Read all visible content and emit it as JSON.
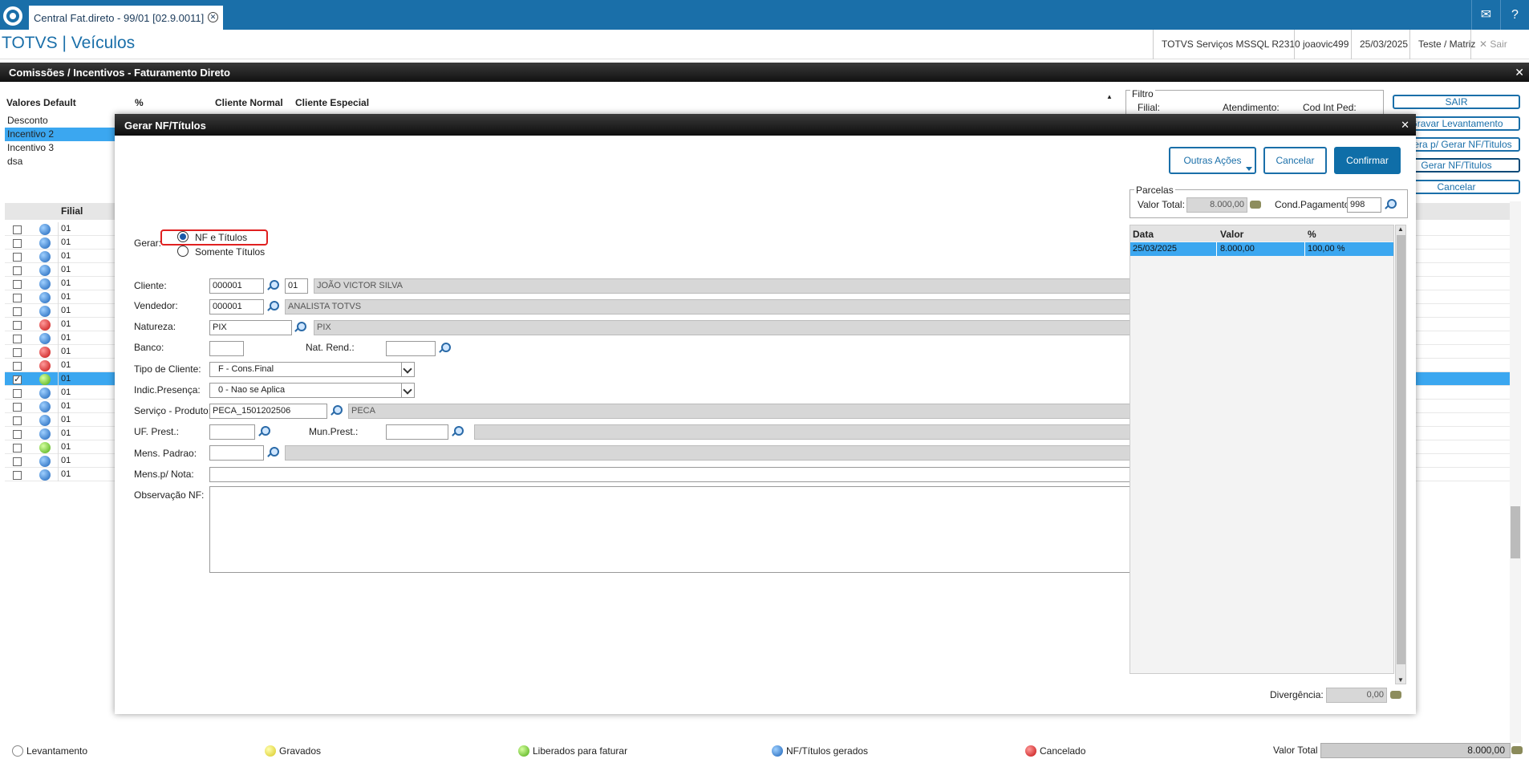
{
  "topbar": {
    "tab_title": "Central Fat.direto - 99/01 [02.9.0011]",
    "mail_icon": "mail-icon",
    "help_icon": "help-icon"
  },
  "header": {
    "app_title": "TOTVS | Veículos",
    "environment": "TOTVS Serviços MSSQL R2310",
    "user": "joaovic499",
    "date": "25/03/2025",
    "company": "Teste / Matriz",
    "logout": "Sair"
  },
  "window": {
    "title": "Comissões / Incentivos - Faturamento Direto"
  },
  "background": {
    "grid_headers": [
      "Valores Default",
      "%",
      "Cliente Normal",
      "Cliente Especial"
    ],
    "grid_rows": [
      "Desconto",
      "Incentivo 2",
      "Incentivo 3",
      "dsa"
    ],
    "filter_title": "Filtro",
    "filter_labels": [
      "Filial:",
      "Atendimento:",
      "Cod Int Ped:"
    ],
    "side_buttons": [
      "SAIR",
      "Gravar Levantamento",
      "Libera p/ Gerar NF/Titulos",
      "Gerar NF/Titulos",
      "Cancelar"
    ],
    "list_header": "Filial",
    "list_rows": [
      {
        "filial": "01",
        "status": "blue",
        "checked": false
      },
      {
        "filial": "01",
        "status": "blue",
        "checked": false
      },
      {
        "filial": "01",
        "status": "blue",
        "checked": false
      },
      {
        "filial": "01",
        "status": "blue",
        "checked": false
      },
      {
        "filial": "01",
        "status": "blue",
        "checked": false
      },
      {
        "filial": "01",
        "status": "blue",
        "checked": false
      },
      {
        "filial": "01",
        "status": "blue",
        "checked": false
      },
      {
        "filial": "01",
        "status": "red",
        "checked": false
      },
      {
        "filial": "01",
        "status": "blue",
        "checked": false
      },
      {
        "filial": "01",
        "status": "red",
        "checked": false
      },
      {
        "filial": "01",
        "status": "red",
        "checked": false
      },
      {
        "filial": "01",
        "status": "green",
        "checked": true
      },
      {
        "filial": "01",
        "status": "blue",
        "checked": false
      },
      {
        "filial": "01",
        "status": "blue",
        "checked": false
      },
      {
        "filial": "01",
        "status": "blue",
        "checked": false
      },
      {
        "filial": "01",
        "status": "blue",
        "checked": false
      },
      {
        "filial": "01",
        "status": "green",
        "checked": false
      },
      {
        "filial": "01",
        "status": "blue",
        "checked": false
      },
      {
        "filial": "01",
        "status": "blue",
        "checked": false
      }
    ],
    "legend": [
      {
        "label": "Levantamento",
        "color": "white"
      },
      {
        "label": "Gravados",
        "color": "yellow"
      },
      {
        "label": "Liberados para faturar",
        "color": "green"
      },
      {
        "label": "NF/Títulos gerados",
        "color": "blue"
      },
      {
        "label": "Cancelado",
        "color": "red"
      }
    ],
    "valor_total_label": "Valor Total",
    "valor_total": "8.000,00"
  },
  "modal": {
    "title": "Gerar NF/Títulos",
    "buttons": {
      "outras_acoes": "Outras Ações",
      "cancelar": "Cancelar",
      "confirmar": "Confirmar"
    },
    "gerar_label": "Gerar:",
    "radio_nf_titulos": "NF e Títulos",
    "radio_somente_titulos": "Somente Títulos",
    "cliente": {
      "label": "Cliente:",
      "code": "000001",
      "loja": "01",
      "name": "JOÃO VICTOR SILVA"
    },
    "vendedor": {
      "label": "Vendedor:",
      "code": "000001",
      "name": "ANALISTA TOTVS"
    },
    "natureza": {
      "label": "Natureza:",
      "code": "PIX",
      "desc": "PIX"
    },
    "banco": {
      "label": "Banco:",
      "value": ""
    },
    "nat_rend": {
      "label": "Nat. Rend.:",
      "value": ""
    },
    "tipo_cliente": {
      "label": "Tipo de Cliente:",
      "value": "F - Cons.Final"
    },
    "indic_presenca": {
      "label": "Indic.Presença:",
      "value": "0 - Nao se Aplica"
    },
    "servico_produto": {
      "label": "Serviço - Produto:",
      "code": "PECA_1501202506",
      "desc": "PECA"
    },
    "uf_prest": {
      "label": "UF. Prest.:",
      "value": ""
    },
    "mun_prest": {
      "label": "Mun.Prest.:",
      "value": "",
      "desc": ""
    },
    "mens_padrao": {
      "label": "Mens. Padrao:",
      "value": "",
      "desc": ""
    },
    "mens_nota": {
      "label": "Mens.p/ Nota:",
      "value": ""
    },
    "observacao": {
      "label": "Observação NF:",
      "value": ""
    },
    "parcelas": {
      "title": "Parcelas",
      "valor_total_label": "Valor Total:",
      "valor_total": "8.000,00",
      "cond_pagamento_label": "Cond.Pagamento:",
      "cond_pagamento": "998",
      "headers": [
        "Data",
        "Valor",
        "%"
      ],
      "rows": [
        {
          "data": "25/03/2025",
          "valor": "8.000,00",
          "perc": "100,00 %"
        }
      ]
    },
    "divergencia_label": "Divergência:",
    "divergencia": "0,00"
  }
}
